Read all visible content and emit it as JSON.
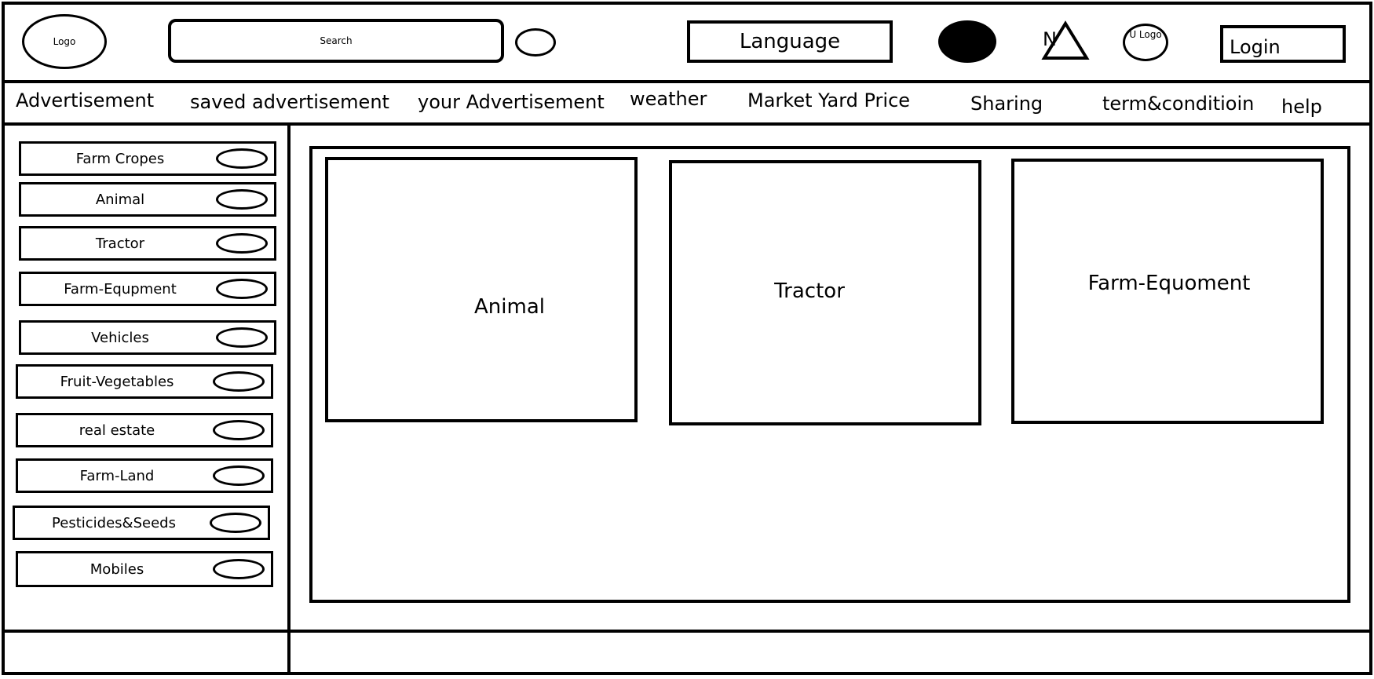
{
  "header": {
    "logo": "Logo",
    "search_placeholder": "Search",
    "language": "Language",
    "notification_letter": "N",
    "user_logo": "U Logo",
    "login": "Login"
  },
  "nav": {
    "items": [
      "Advertisement",
      "saved advertisement",
      "your Advertisement",
      "weather",
      "Market Yard Price",
      "Sharing",
      "term&conditioin",
      "help"
    ]
  },
  "sidebar": {
    "items": [
      "Farm Cropes",
      "Animal",
      "Tractor",
      "Farm-Equpment",
      "Vehicles",
      "Fruit-Vegetables",
      "real estate",
      "Farm-Land",
      "Pesticides&Seeds",
      "Mobiles"
    ]
  },
  "main": {
    "cards": [
      "Animal",
      "Tractor",
      "Farm-Equoment"
    ]
  }
}
